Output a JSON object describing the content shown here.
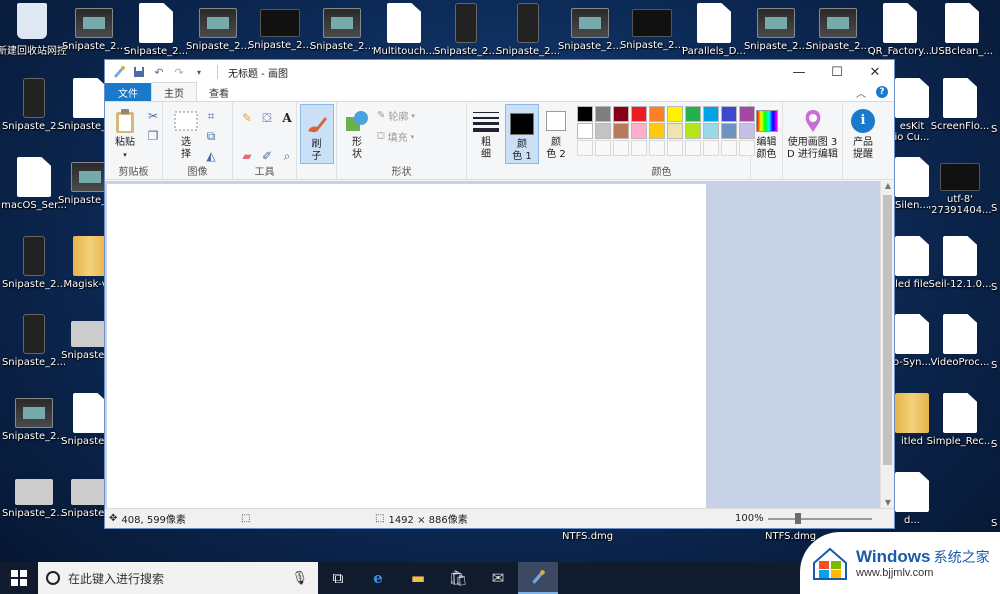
{
  "desktop": {
    "top_row": [
      "新建回收站网控",
      "Snipaste_2...",
      "Snipaste_2...",
      "Snipaste_2...",
      "Snipaste_2...",
      "Snipaste_2...",
      "Multitouch...",
      "Snipaste_2...",
      "Snipaste_2...",
      "Snipaste_2...",
      "Snipaste_2...",
      "Parallels_D...",
      "Snipaste_2...",
      "Snipaste_2...",
      "QR_Factory...",
      "USBclean_..."
    ],
    "left_col1": [
      "Snipaste_2...",
      "macOS_Ser...",
      "Snipaste_2...",
      "Snipaste_2...",
      "Snipaste_2...",
      "Snipaste_2..."
    ],
    "left_col2": [
      "Snipaste_2...",
      "Snipaste_2...",
      "Magisk-v...",
      "Snipaste_...",
      "Snipaste_...",
      "Snipaste_..."
    ],
    "right_col1": [
      "esKit\nio Cu...",
      "Silen...",
      "led file",
      "o-Syn...",
      "itled",
      "d..."
    ],
    "right_col2": [
      "ScreenFlo...",
      "utf-8'\n'27391404...",
      "Seil-12.1.0...",
      "VideoProc...",
      "Simple_Rec..."
    ],
    "right_col3": [
      "S",
      "S",
      "S",
      "S",
      "S",
      "S"
    ],
    "ntfs_a": "NTFS.dmg",
    "ntfs_b": "NTFS.dmg"
  },
  "window": {
    "title": "无标题 - 画图",
    "tabs": {
      "file": "文件",
      "home": "主页",
      "view": "查看"
    },
    "groups": {
      "clipboard": {
        "label": "剪贴板",
        "paste": "粘贴"
      },
      "image": {
        "label": "图像",
        "select": "选\n择"
      },
      "tools": {
        "label": "工具"
      },
      "brush": {
        "label": "刷\n子"
      },
      "shapes": {
        "label": "形状",
        "shapes_btn": "形\n状",
        "outline": "轮廓",
        "fill": "填充"
      },
      "size": {
        "label": "粗\n细"
      },
      "color1": {
        "label": "颜\n色 1"
      },
      "color2": {
        "label": "颜\n色 2"
      },
      "colors": {
        "label": "颜色"
      },
      "edit_colors": {
        "label": "编辑\n颜色"
      },
      "paint3d": {
        "label": "使用画图 3\nD 进行编辑"
      },
      "product": {
        "label": "产品\n提醒"
      }
    },
    "palette": [
      "#000000",
      "#7f7f7f",
      "#880015",
      "#ed1c24",
      "#ff7f27",
      "#fff200",
      "#22b14c",
      "#00a2e8",
      "#3f48cc",
      "#a349a4",
      "#ffffff",
      "#c3c3c3",
      "#b97a57",
      "#ffaec9",
      "#ffc90e",
      "#efe4b0",
      "#b5e61d",
      "#99d9ea",
      "#7092be",
      "#c8bfe7"
    ],
    "status": {
      "cursor_pos": "408, 599像素",
      "image_size": "1492 × 886像素",
      "zoom": "100%"
    }
  },
  "taskbar": {
    "search_placeholder": "在此键入进行搜索"
  },
  "watermark": {
    "title": "Windows",
    "subtitle": "系统之家",
    "url": "www.bjjmlv.com"
  },
  "colors": {
    "accent": "#1979ca",
    "workspace": "#c8d2e6"
  }
}
